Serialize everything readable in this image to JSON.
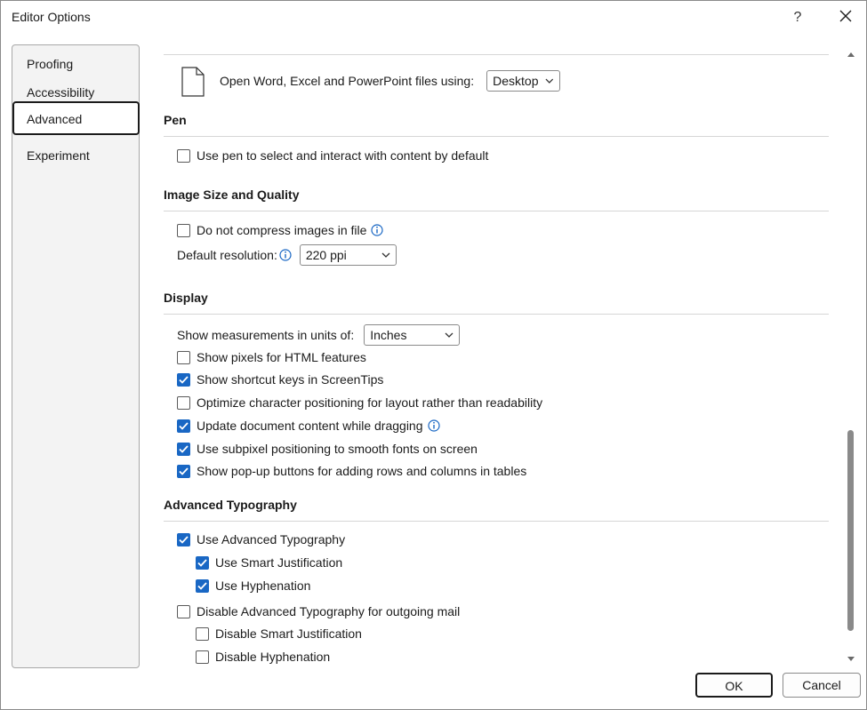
{
  "window": {
    "title": "Editor Options",
    "help_label": "?",
    "close_icon": "close-icon"
  },
  "sidebar": {
    "items": [
      {
        "label": "Proofing",
        "active": false
      },
      {
        "label": "Accessibility",
        "active": false
      },
      {
        "label": "Advanced",
        "active": true
      },
      {
        "label": "Experiment",
        "active": false
      }
    ]
  },
  "open_files": {
    "label": "Open Word, Excel and PowerPoint files using:",
    "select_value": "Desktop",
    "icon": "document-icon"
  },
  "pen": {
    "title": "Pen",
    "options": [
      {
        "label": "Use pen to select and interact with content by default",
        "checked": false
      }
    ]
  },
  "image": {
    "title": "Image Size and Quality",
    "compress_label": "Do not compress images in file",
    "compress_checked": false,
    "resolution_label": "Default resolution:",
    "resolution_value": "220 ppi"
  },
  "display": {
    "title": "Display",
    "units_label": "Show measurements in units of:",
    "units_value": "Inches",
    "options": [
      {
        "label": "Show pixels for HTML features",
        "checked": false
      },
      {
        "label": "Show shortcut keys in ScreenTips",
        "checked": true
      },
      {
        "label": "Optimize character positioning for layout rather than readability",
        "checked": false
      },
      {
        "label": "Update document content while dragging",
        "checked": true
      },
      {
        "label": "Use subpixel positioning to smooth fonts on screen",
        "checked": true
      },
      {
        "label": "Show pop-up buttons for adding rows and columns in tables",
        "checked": true
      }
    ]
  },
  "typography": {
    "title": "Advanced Typography",
    "options": [
      {
        "label": "Use Advanced Typography",
        "checked": true
      },
      {
        "label": "Use Smart Justification",
        "checked": true
      },
      {
        "label": "Use Hyphenation",
        "checked": true
      },
      {
        "label": "Disable Advanced Typography for outgoing mail",
        "checked": false
      },
      {
        "label": "Disable Smart Justification",
        "checked": false
      },
      {
        "label": "Disable Hyphenation",
        "checked": false
      }
    ]
  },
  "footer": {
    "ok_label": "OK",
    "cancel_label": "Cancel"
  },
  "colors": {
    "accent": "#1967c4",
    "border": "#8a8a8a",
    "sidebar_bg": "#f3f3f3"
  }
}
